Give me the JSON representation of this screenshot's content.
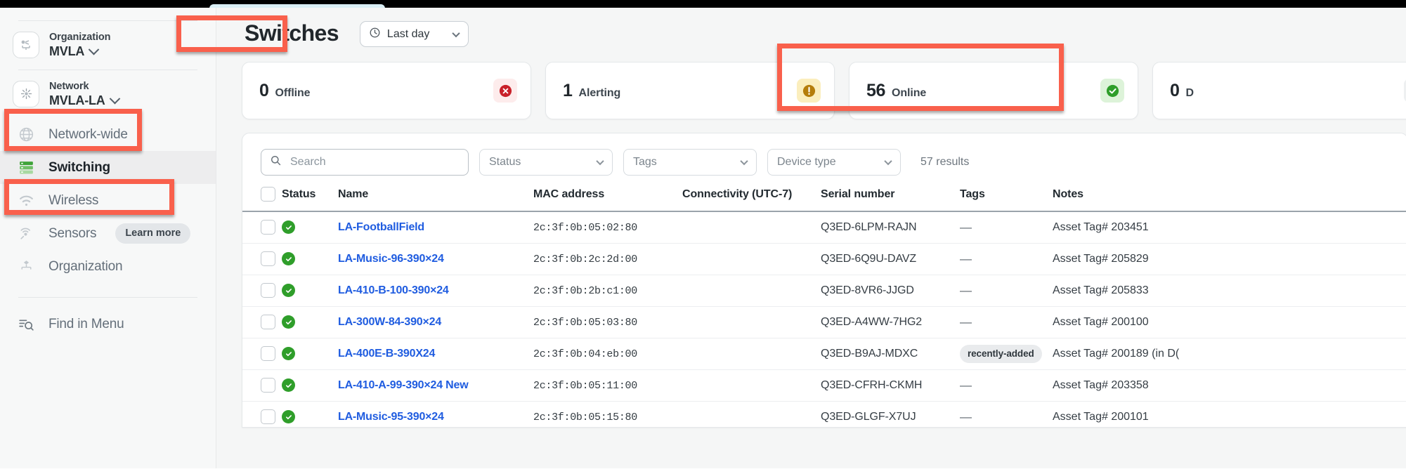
{
  "sidebar": {
    "org": {
      "label": "Organization",
      "value": "MVLA",
      "icon": "organization-switcher-icon"
    },
    "network": {
      "label": "Network",
      "value": "MVLA-LA",
      "icon": "network-switcher-icon"
    },
    "items": [
      {
        "label": "Network-wide",
        "icon": "globe-icon",
        "active": false
      },
      {
        "label": "Switching",
        "icon": "switch-stack-icon",
        "active": true
      },
      {
        "label": "Wireless",
        "icon": "wifi-icon",
        "active": false
      },
      {
        "label": "Sensors",
        "icon": "sensor-icon",
        "active": false,
        "pill": "Learn more"
      },
      {
        "label": "Organization",
        "icon": "organization-icon",
        "active": false
      }
    ],
    "find_in_menu": {
      "label": "Find in Menu",
      "icon": "find-in-menu-icon"
    }
  },
  "header": {
    "title": "Switches",
    "date_range": {
      "value": "Last day",
      "icon": "clock-icon"
    }
  },
  "cards": [
    {
      "count": "0",
      "label": "Offline",
      "icon": "error-circle-icon",
      "icon_color": "#c9212a",
      "badge_bg": "#fdecec"
    },
    {
      "count": "1",
      "label": "Alerting",
      "icon": "warning-circle-icon",
      "icon_color": "#b57d0a",
      "badge_bg": "#fbeebd"
    },
    {
      "count": "56",
      "label": "Online",
      "icon": "check-circle-icon",
      "icon_color": "#2f9e2a",
      "badge_bg": "#ddf3d9"
    },
    {
      "count": "0",
      "label": "D",
      "icon": "dormant-circle-icon",
      "icon_color": "#7b848c",
      "badge_bg": "#eef0f1"
    }
  ],
  "filters": {
    "search": {
      "placeholder": "Search",
      "value": "",
      "icon": "search-icon"
    },
    "status": {
      "label": "Status"
    },
    "tags": {
      "label": "Tags"
    },
    "device_type": {
      "label": "Device type"
    },
    "results": "57 results"
  },
  "table": {
    "columns": [
      "Status",
      "Name",
      "MAC address",
      "Connectivity (UTC-7)",
      "Serial number",
      "Tags",
      "Notes"
    ],
    "rows": [
      {
        "status": "online",
        "name": "LA-FootballField",
        "mac": "2c:3f:0b:05:02:80",
        "serial": "Q3ED-6LPM-RAJN",
        "tags": "—",
        "notes": "Asset Tag# 203451"
      },
      {
        "status": "online",
        "name": "LA-Music-96-390×24",
        "mac": "2c:3f:0b:2c:2d:00",
        "serial": "Q3ED-6Q9U-DAVZ",
        "tags": "—",
        "notes": "Asset Tag# 205829"
      },
      {
        "status": "online",
        "name": "LA-410-B-100-390×24",
        "mac": "2c:3f:0b:2b:c1:00",
        "serial": "Q3ED-8VR6-JJGD",
        "tags": "—",
        "notes": "Asset Tag# 205833"
      },
      {
        "status": "online",
        "name": "LA-300W-84-390×24",
        "mac": "2c:3f:0b:05:03:80",
        "serial": "Q3ED-A4WW-7HG2",
        "tags": "—",
        "notes": "Asset Tag# 200100"
      },
      {
        "status": "online",
        "name": "LA-400E-B-390X24",
        "mac": "2c:3f:0b:04:eb:00",
        "serial": "Q3ED-B9AJ-MDXC",
        "tags": "recently-added",
        "notes": "Asset Tag# 200189 (in D("
      },
      {
        "status": "online",
        "name": "LA-410-A-99-390×24 New",
        "mac": "2c:3f:0b:05:11:00",
        "serial": "Q3ED-CFRH-CKMH",
        "tags": "—",
        "notes": "Asset Tag# 203358"
      },
      {
        "status": "online",
        "name": "LA-Music-95-390×24",
        "mac": "2c:3f:0b:05:15:80",
        "serial": "Q3ED-GLGF-X7UJ",
        "tags": "—",
        "notes": "Asset Tag# 200101"
      }
    ]
  },
  "annotations": {
    "highlight_color": "#f9604c",
    "boxes": [
      "network-switcher",
      "switching-nav-item",
      "page-title",
      "online-card"
    ]
  }
}
